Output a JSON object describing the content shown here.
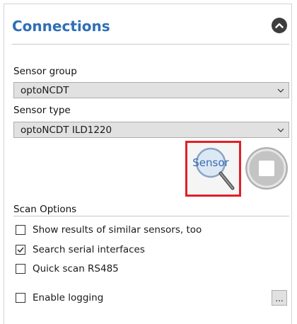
{
  "panel": {
    "title": "Connections",
    "collapse_icon": "chevron-up-circle-icon"
  },
  "sensor_group": {
    "label": "Sensor group",
    "value": "optoNCDT"
  },
  "sensor_type": {
    "label": "Sensor type",
    "value": "optoNCDT ILD1220"
  },
  "sensor_button": {
    "icon_text": "Sensor",
    "icon": "magnifier-sensor-icon",
    "highlight_color": "#e02026"
  },
  "stop_button": {
    "icon": "stop-icon"
  },
  "scan_options": {
    "label": "Scan Options",
    "options": [
      {
        "label": "Show results of similar sensors, too",
        "checked": false
      },
      {
        "label": "Search serial interfaces",
        "checked": true
      },
      {
        "label": "Quick scan RS485",
        "checked": false
      }
    ]
  },
  "logging": {
    "label": "Enable logging",
    "checked": false,
    "browse_label": "..."
  },
  "colors": {
    "title": "#2e6fb5",
    "select_bg": "#e1e1e1"
  }
}
